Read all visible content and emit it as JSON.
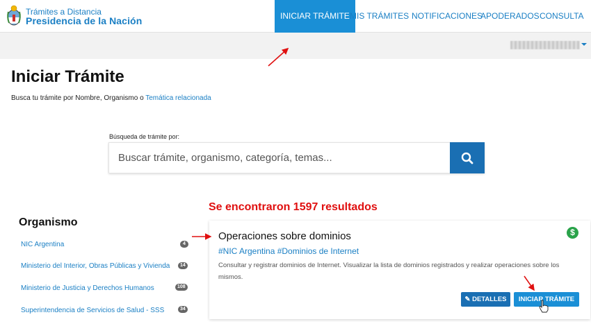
{
  "brand": {
    "line1": "Trámites a Distancia",
    "line2": "Presidencia de la Nación"
  },
  "nav": {
    "items": [
      "INICIAR TRÁMITE",
      "MIS TRÁMITES",
      "NOTIFICACIONES",
      "APODERADOS",
      "CONSULTA"
    ],
    "active_index": 0
  },
  "page": {
    "title": "Iniciar Trámite",
    "subtitle_prefix": "Busca tu trámite por Nombre, Organismo",
    "subtitle_sep": " o ",
    "subtitle_link": "Temática relacionada"
  },
  "search": {
    "label": "Búsqueda de trámite por:",
    "placeholder": "Buscar trámite, organismo, categoría, temas..."
  },
  "results": {
    "text": "Se encontraron 1597 resultados"
  },
  "sidebar": {
    "title": "Organismo",
    "items": [
      {
        "label": "NIC Argentina",
        "count": "4"
      },
      {
        "label": "Ministerio del Interior, Obras Públicas y Vivienda",
        "count": "14"
      },
      {
        "label": "Ministerio de Justicia y Derechos Humanos",
        "count": "108"
      },
      {
        "label": "Superintendencia de Servicios de Salud - SSS",
        "count": "34"
      }
    ]
  },
  "card": {
    "title": "Operaciones sobre dominios",
    "tags": "#NIC Argentina #Dominios de Internet",
    "description": "Consultar y registrar dominios de Internet. Visualizar la lista de dominios registrados y realizar operaciones sobre los mismos.",
    "details_label": "DETALLES",
    "start_label": "INICIAR TRÁMITE",
    "price_icon": "dollar-icon"
  },
  "colors": {
    "brand_blue": "#1a7fc4",
    "nav_active": "#1a8fd6",
    "search_button": "#1a6fb3",
    "results_red": "#e01010",
    "annotation_red": "#e01010"
  }
}
